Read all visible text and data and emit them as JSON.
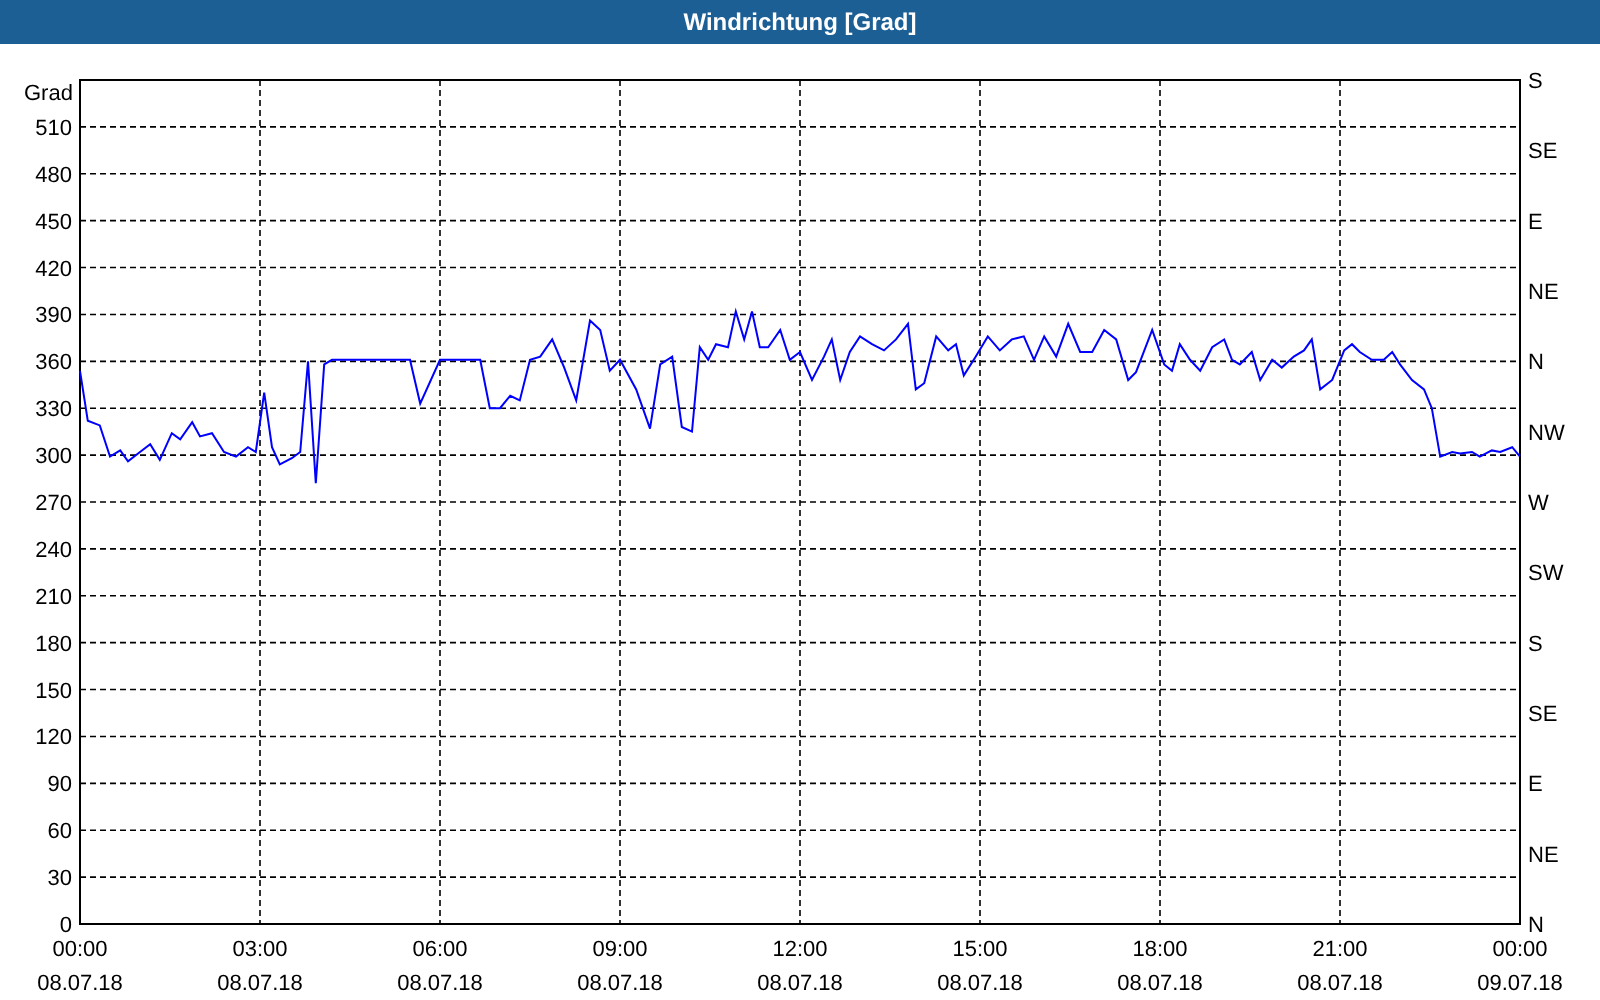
{
  "window": {
    "title": "Windrichtung [Grad]"
  },
  "right_axis_labels": [
    "S",
    "SE",
    "E",
    "NE",
    "N",
    "NW",
    "W",
    "SW",
    "S",
    "SE",
    "E",
    "NE",
    "N"
  ],
  "x_axis_dates": [
    "08.07.18",
    "08.07.18",
    "08.07.18",
    "08.07.18",
    "08.07.18",
    "08.07.18",
    "08.07.18",
    "08.07.18",
    "09.07.18"
  ],
  "chart_data": {
    "type": "line",
    "grid": true,
    "ylabel": "Grad",
    "xlim": [
      0,
      24
    ],
    "ylim": [
      0,
      540
    ],
    "yticks": [
      0,
      30,
      60,
      90,
      120,
      150,
      180,
      210,
      240,
      270,
      300,
      330,
      360,
      390,
      420,
      450,
      480,
      510
    ],
    "xticks": [
      {
        "value": 0,
        "label": "00:00"
      },
      {
        "value": 3,
        "label": "03:00"
      },
      {
        "value": 6,
        "label": "06:00"
      },
      {
        "value": 9,
        "label": "09:00"
      },
      {
        "value": 12,
        "label": "12:00"
      },
      {
        "value": 15,
        "label": "15:00"
      },
      {
        "value": 18,
        "label": "18:00"
      },
      {
        "value": 21,
        "label": "21:00"
      },
      {
        "value": 24,
        "label": "00:00"
      }
    ],
    "x": [
      0,
      0.13,
      0.33,
      0.5,
      0.67,
      0.8,
      1,
      1.17,
      1.33,
      1.53,
      1.67,
      1.87,
      2,
      2.2,
      2.4,
      2.6,
      2.8,
      2.93,
      3.07,
      3.2,
      3.33,
      3.53,
      3.67,
      3.8,
      3.93,
      4.07,
      4.2,
      5.5,
      5.67,
      6,
      6.67,
      6.83,
      7,
      7.17,
      7.33,
      7.5,
      7.67,
      7.87,
      8.07,
      8.27,
      8.5,
      8.67,
      8.83,
      9,
      9.27,
      9.5,
      9.67,
      9.87,
      10.03,
      10.2,
      10.33,
      10.47,
      10.6,
      10.8,
      10.93,
      11.07,
      11.2,
      11.33,
      11.47,
      11.67,
      11.83,
      12,
      12.2,
      12.4,
      12.53,
      12.67,
      12.83,
      13,
      13.2,
      13.4,
      13.6,
      13.8,
      13.93,
      14.07,
      14.27,
      14.47,
      14.6,
      14.73,
      14.93,
      15.13,
      15.33,
      15.53,
      15.73,
      15.9,
      16.07,
      16.27,
      16.47,
      16.67,
      16.87,
      17.07,
      17.27,
      17.47,
      17.6,
      17.87,
      18.07,
      18.2,
      18.33,
      18.5,
      18.67,
      18.87,
      19.07,
      19.2,
      19.33,
      19.53,
      19.67,
      19.87,
      20.03,
      20.23,
      20.4,
      20.53,
      20.67,
      20.87,
      21.07,
      21.2,
      21.33,
      21.53,
      21.73,
      21.87,
      22,
      22.2,
      22.4,
      22.53,
      22.67,
      22.87,
      23,
      23.2,
      23.33,
      23.53,
      23.67,
      23.87,
      24
    ],
    "series": [
      {
        "color": "#0000ff",
        "values": [
          354,
          322,
          319,
          299,
          303,
          296,
          302,
          307,
          297,
          314,
          310,
          321,
          312,
          314,
          302,
          299,
          305,
          302,
          340,
          305,
          294,
          298,
          302,
          360,
          282,
          358,
          361,
          361,
          333,
          361,
          361,
          330,
          330,
          338,
          335,
          361,
          363,
          374,
          356,
          335,
          386,
          380,
          354,
          361,
          342,
          317,
          358,
          363,
          318,
          315,
          369,
          361,
          371,
          369,
          392,
          374,
          392,
          369,
          369,
          380,
          361,
          366,
          348,
          363,
          374,
          348,
          366,
          376,
          371,
          367,
          374,
          384,
          342,
          346,
          376,
          367,
          371,
          351,
          363,
          376,
          367,
          374,
          376,
          361,
          376,
          363,
          384,
          366,
          366,
          380,
          374,
          348,
          353,
          380,
          358,
          354,
          371,
          361,
          354,
          369,
          374,
          361,
          358,
          366,
          348,
          361,
          356,
          363,
          367,
          374,
          342,
          348,
          367,
          371,
          366,
          361,
          361,
          366,
          358,
          348,
          342,
          330,
          299,
          302,
          301,
          302,
          299,
          303,
          302,
          305,
          299
        ]
      }
    ]
  }
}
